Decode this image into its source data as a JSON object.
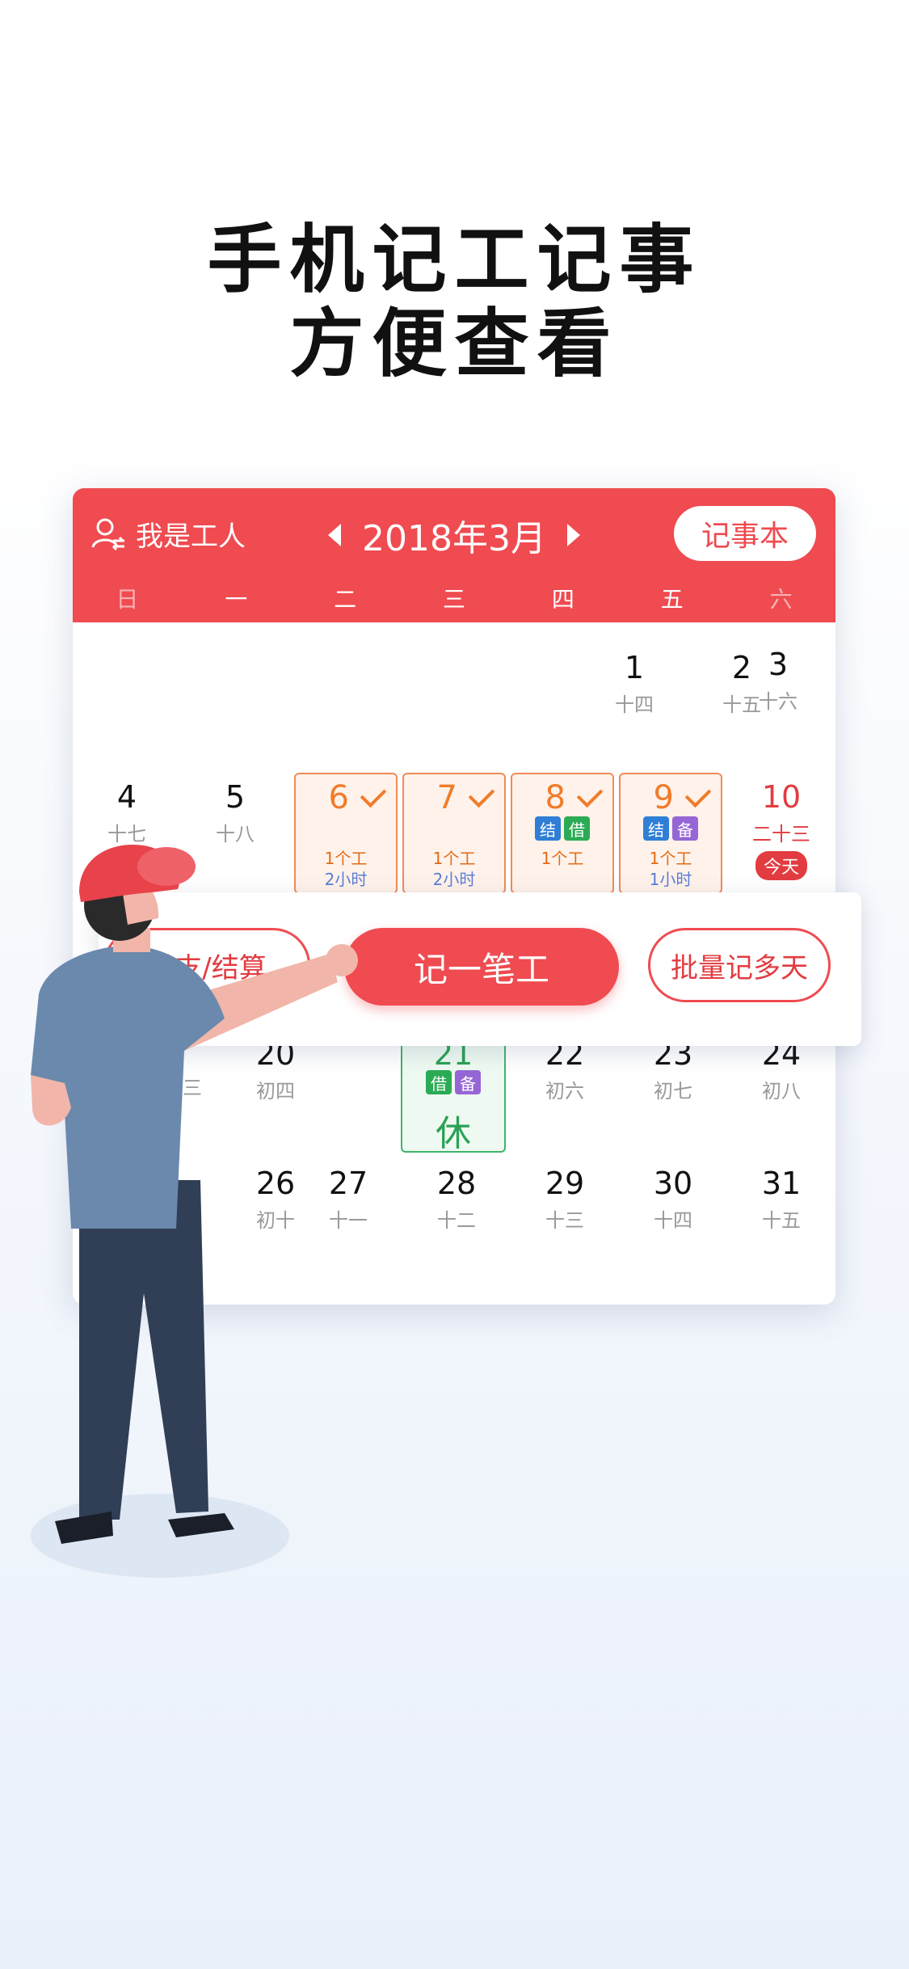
{
  "headline": {
    "line1": "手机记工记事",
    "line2": "方便查看"
  },
  "header": {
    "user_label": "我是工人",
    "month_label": "2018年3月",
    "notebook_label": "记事本",
    "accent": "#ef4b50"
  },
  "weekdays": [
    "日",
    "一",
    "二",
    "三",
    "四",
    "五",
    "六"
  ],
  "week1": [
    {
      "day": "1",
      "lunar": "十四"
    },
    {
      "day": "2",
      "lunar": "十五"
    },
    {
      "day": "3",
      "lunar": "十六"
    }
  ],
  "week2": [
    {
      "day": "4",
      "lunar": "十七"
    },
    {
      "day": "5",
      "lunar": "十八"
    },
    {
      "day": "6",
      "tags": [],
      "work": "1个工",
      "hours": "2小时"
    },
    {
      "day": "7",
      "tags": [],
      "work": "1个工",
      "hours": "2小时"
    },
    {
      "day": "8",
      "tags": [
        "结",
        "借"
      ],
      "work": "1个工"
    },
    {
      "day": "9",
      "tags": [
        "结",
        "备"
      ],
      "work": "1个工",
      "hours": "1小时"
    },
    {
      "day": "10",
      "lunar": "二十三",
      "badge": "今天"
    }
  ],
  "week4": [
    {
      "day": "20",
      "lunar": "初四"
    },
    {
      "day": "21",
      "tags": [
        "借",
        "备"
      ],
      "rest": "休"
    },
    {
      "day": "22",
      "lunar": "初六"
    },
    {
      "day": "23",
      "lunar": "初七"
    },
    {
      "day": "24",
      "lunar": "初八"
    },
    {
      "lunar_partial": "初三"
    }
  ],
  "week5": [
    {
      "day": "26",
      "lunar": "初十"
    },
    {
      "day": "27",
      "lunar": "十一"
    },
    {
      "day": "28",
      "lunar": "十二"
    },
    {
      "day": "29",
      "lunar": "十三"
    },
    {
      "day": "30",
      "lunar": "十四"
    },
    {
      "day": "31",
      "lunar": "十五"
    }
  ],
  "actions": {
    "left": "借支/结算",
    "main": "记一笔工",
    "right": "批量记多天"
  }
}
